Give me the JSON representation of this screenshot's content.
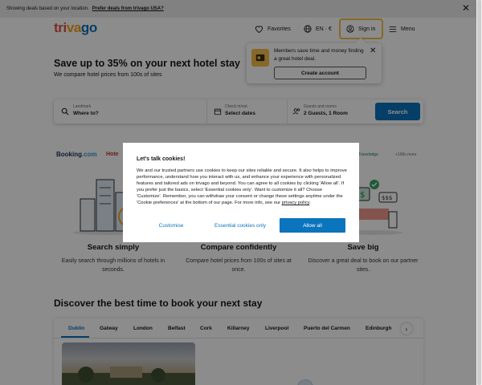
{
  "notice": {
    "text": "Showing deals based on your location.",
    "link": "Prefer deals from trivago USA?"
  },
  "header": {
    "logo_parts": [
      "tri",
      "va",
      "go"
    ],
    "favorites": "Favorites",
    "language": "EN · €",
    "sign_in": "Sign in",
    "menu": "Menu"
  },
  "hero": {
    "title": "Save up to 35% on your next hotel stay",
    "subtitle": "We compare hotel prices from 100s of sites"
  },
  "tooltip": {
    "message": "Members save time and money finding a great hotel deal.",
    "button": "Create account"
  },
  "search": {
    "destination_label": "Landmark",
    "destination_value": "Where to?",
    "dates_label": "Check in/out",
    "dates_value": "Select dates",
    "guests_label": "Guests and rooms",
    "guests_value": "2 Guests, 1 Room",
    "button": "Search"
  },
  "partners": {
    "booking_1": "Booking",
    "booking_2": ".com",
    "hotels": "Hote",
    "travelodge": "Travelodge",
    "more": "+100s more"
  },
  "features": [
    {
      "title": "Search simply",
      "desc": "Easily search through millions of hotels in seconds."
    },
    {
      "title": "Compare confidently",
      "desc": "Compare hotel prices from 100s of sites at once."
    },
    {
      "title": "Save big",
      "desc": "Discover a great deal to book on our partner sites."
    }
  ],
  "discover": {
    "title": "Discover the best time to book your next stay",
    "tabs": [
      "Dublin",
      "Galway",
      "London",
      "Belfast",
      "Cork",
      "Killarney",
      "Liverpool",
      "Puerto del Carmen",
      "Edinburgh"
    ],
    "active_tab": "Dublin"
  },
  "cookie": {
    "title": "Let's talk cookies!",
    "body_main": "We and our trusted partners use cookies to keep our sites reliable and secure. It also helps to improve performance, understand how you interact with us, and enhance your experience with personalized features and tailored ads on trivago and beyond. You can agree to all cookies by clicking 'Allow all'. If you prefer just the basics, select 'Essential cookies only'. Want to customize it all? Choose 'Customize'. Remember, you can withdraw your consent or change these settings anytime under the 'Cookie preferences' at the bottom of our page. For more info, see our",
    "privacy_link": "privacy policy",
    "customise": "Customise",
    "essential": "Essential cookies only",
    "allow_all": "Allow all"
  },
  "colors": {
    "brand_blue": "#0a74bc",
    "brand_red": "#e2513f",
    "brand_orange": "#f6a21c",
    "highlight": "#f5bd4a"
  }
}
